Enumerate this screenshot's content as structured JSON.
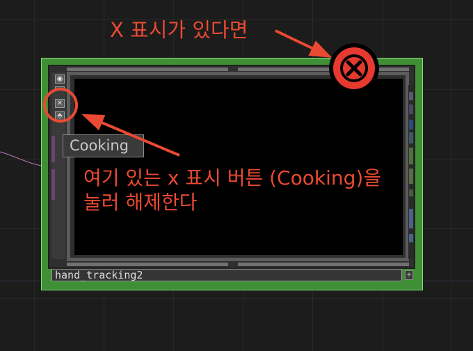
{
  "annotations": {
    "title": "X 표시가 있다면",
    "instruction_line1": "여기 있는 x 표시 버튼 (Cooking)을",
    "instruction_line2": "눌러 해제한다"
  },
  "node": {
    "name": "hand_tracking2",
    "tooltip": "Cooking",
    "status_badge_icon": "close-circle-icon",
    "side_buttons": [
      {
        "name": "view-toggle-button",
        "glyph": "◉"
      },
      {
        "name": "cooking-button",
        "glyph": "✕"
      },
      {
        "name": "clone-button",
        "glyph": "⬘"
      }
    ]
  },
  "colors": {
    "annotation": "#ea4a32",
    "node_border": "#3f8f35",
    "viewer_bg": "#000000"
  }
}
